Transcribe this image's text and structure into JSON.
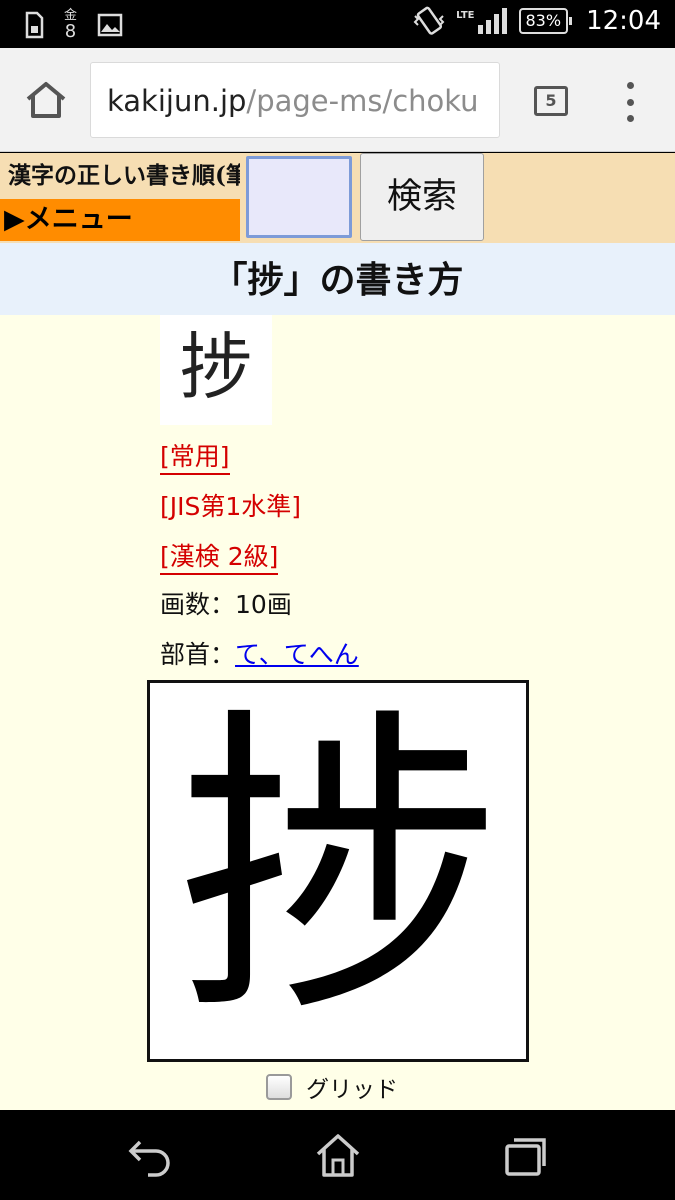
{
  "status_bar": {
    "date_weekday": "金",
    "date_day": "8",
    "network": "LTE",
    "battery": "83%",
    "clock": "12:04"
  },
  "browser": {
    "url_host": "kakijun.jp",
    "url_path": "/page-ms/choku",
    "tab_count": "5"
  },
  "site": {
    "title": "漢字の正しい書き順(筆順)",
    "menu_label": "▶メニュー",
    "search_value": "",
    "search_button": "検索"
  },
  "page": {
    "heading": "「捗」の書き方",
    "thumb_char": "捗",
    "tags": [
      "[常用]",
      "[JIS第1水準]",
      "[漢検 2級]"
    ],
    "strokes_label": "画数：",
    "strokes_value": "10画",
    "radical_label": "部首：",
    "radical_link": "て、てへん",
    "stroke_char": "捗",
    "grid_label": "グリッド",
    "grid_checked": false
  },
  "icons": {
    "status_left": [
      "sim-icon",
      "calendar-icon",
      "image-icon"
    ],
    "status_right": [
      "vibrate-icon",
      "signal-icon",
      "battery-icon"
    ],
    "browser": [
      "home-icon",
      "tabs-icon",
      "overflow-menu-icon"
    ],
    "nav": [
      "back-icon",
      "home-icon",
      "recent-apps-icon"
    ]
  }
}
